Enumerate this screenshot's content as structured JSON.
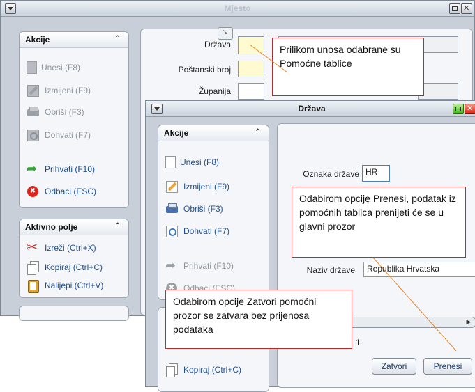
{
  "main_window": {
    "title": "Mjesto",
    "actions_panel": {
      "header": "Akcije",
      "items": [
        {
          "label": "Unesi (F8)",
          "icon": "new-document-icon",
          "enabled": false
        },
        {
          "label": "Izmijeni (F9)",
          "icon": "edit-pencil-icon",
          "enabled": false
        },
        {
          "label": "Obriši (F3)",
          "icon": "delete-printer-icon",
          "enabled": false
        },
        {
          "label": "Dohvati (F7)",
          "icon": "search-icon",
          "enabled": false
        },
        {
          "label": "Prihvati (F10)",
          "icon": "accept-arrow-icon",
          "enabled": true
        },
        {
          "label": "Odbaci (ESC)",
          "icon": "cancel-stop-icon",
          "enabled": true
        }
      ]
    },
    "active_field_panel": {
      "header": "Aktivno polje",
      "items": [
        {
          "label": "Izreži (Ctrl+X)",
          "icon": "scissors-icon"
        },
        {
          "label": "Kopiraj (Ctrl+C)",
          "icon": "copy-icon"
        },
        {
          "label": "Nalijepi (Ctrl+V)",
          "icon": "paste-icon"
        }
      ]
    },
    "form": {
      "drzava_label": "Država",
      "postanski_label": "Poštanski broj",
      "zupanija_label": "Županija"
    }
  },
  "dialog": {
    "title": "Država",
    "actions_panel": {
      "header": "Akcije",
      "items": [
        {
          "label": "Unesi (F8)",
          "icon": "new-document-icon",
          "enabled": true
        },
        {
          "label": "Izmijeni (F9)",
          "icon": "edit-pencil-icon",
          "enabled": true
        },
        {
          "label": "Obriši (F3)",
          "icon": "delete-printer-icon",
          "enabled": true
        },
        {
          "label": "Dohvati (F7)",
          "icon": "search-icon",
          "enabled": true
        },
        {
          "label": "Prihvati (F10)",
          "icon": "accept-arrow-icon",
          "enabled": false
        },
        {
          "label": "Odbaci (ESC)",
          "icon": "cancel-stop-icon",
          "enabled": false
        }
      ],
      "extra_item": "Kopiraj (Ctrl+C)"
    },
    "form": {
      "oznaka_label": "Oznaka države",
      "oznaka_value": "HR",
      "naziv_label": "Naziv države",
      "naziv_value": "Republika Hrvatska",
      "page_number": "1"
    },
    "buttons": {
      "close": "Zatvori",
      "transfer": "Prenesi"
    }
  },
  "callouts": {
    "helper_tables": "Prilikom unosa odabrane su Pomoćne tablice",
    "transfer": "Odabirom opcije Prenesi, podatak iz pomoćnih tablica prenijeti će se u glavni prozor",
    "close": "Odabirom opcije Zatvori pomoćni prozor se zatvara bez prijenosa podataka"
  },
  "colors": {
    "callout_border": "#c0282a",
    "leader_line": "#e8852a",
    "required_field": "#fffbd0"
  }
}
